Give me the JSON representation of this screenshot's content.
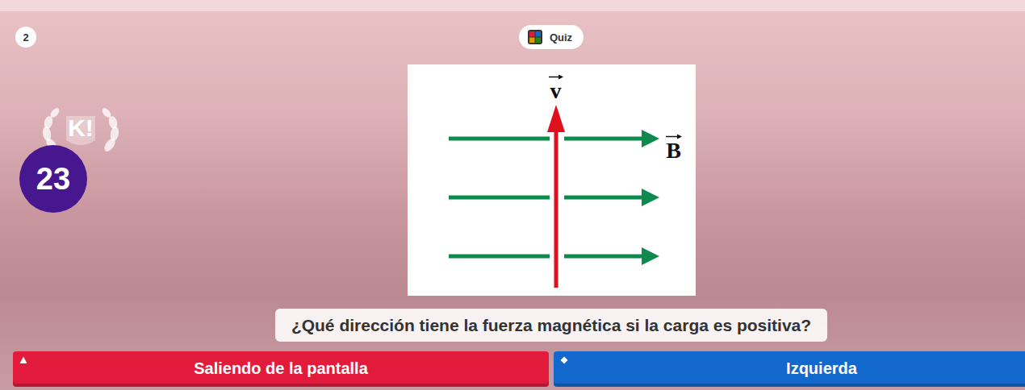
{
  "question_number": "2",
  "badge": {
    "label": "Quiz"
  },
  "logo": {
    "text": "K!"
  },
  "timer": "23",
  "diagram": {
    "velocity_label": "v",
    "field_label": "B"
  },
  "question": "¿Qué dirección tiene la fuerza magnética si la carga es positiva?",
  "answers": [
    {
      "label": "Saliendo de la pantalla",
      "kind": "triangle",
      "color": "#e21b3c"
    },
    {
      "label": "Izquierda",
      "kind": "diamond",
      "color": "#1368ce"
    }
  ]
}
